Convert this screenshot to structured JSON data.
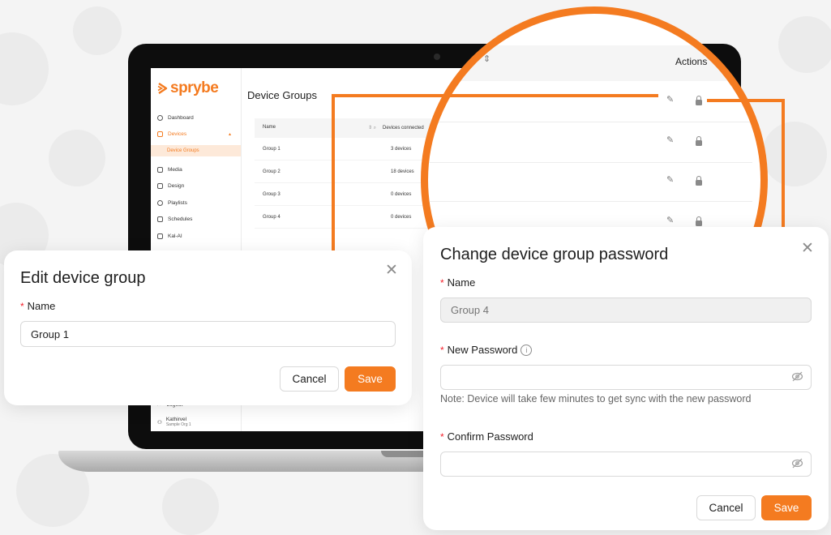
{
  "colors": {
    "accent": "#f47b20",
    "required": "#f5222d"
  },
  "app": {
    "brand": "sprybe",
    "page_title": "Device Groups",
    "sidebar": {
      "items": [
        {
          "label": "Dashboard",
          "icon": "dashboard-icon"
        },
        {
          "label": "Devices",
          "icon": "devices-icon"
        },
        {
          "label": "Media",
          "icon": "media-icon"
        },
        {
          "label": "Design",
          "icon": "design-icon"
        },
        {
          "label": "Playlists",
          "icon": "playlists-icon"
        },
        {
          "label": "Schedules",
          "icon": "schedules-icon"
        },
        {
          "label": "Kal-AI",
          "icon": "ai-icon"
        }
      ],
      "sub_item": "Device Groups",
      "logout": "Logout",
      "user_name": "Kathirvel",
      "user_org": "Sample Org 1"
    },
    "table": {
      "columns": [
        "Name",
        "Devices connected",
        "Actions"
      ],
      "rows": [
        {
          "name": "Group 1",
          "devices": "3 devices"
        },
        {
          "name": "Group 2",
          "devices": "18 devices"
        },
        {
          "name": "Group 3",
          "devices": "0 devices"
        },
        {
          "name": "Group 4",
          "devices": "0 devices"
        }
      ]
    }
  },
  "edit_dialog": {
    "title": "Edit device group",
    "name_label": "Name",
    "name_value": "Group 1",
    "cancel_label": "Cancel",
    "save_label": "Save"
  },
  "password_dialog": {
    "title": "Change device group password",
    "name_label": "Name",
    "name_placeholder": "Group 4",
    "new_password_label": "New Password",
    "note": "Note: Device will take few minutes to get sync with the new password",
    "confirm_password_label": "Confirm Password",
    "cancel_label": "Cancel",
    "save_label": "Save"
  }
}
